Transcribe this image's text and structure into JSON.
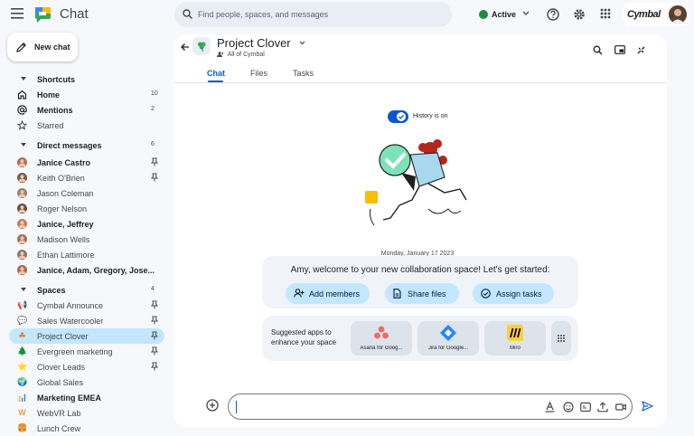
{
  "app": {
    "title": "Chat",
    "search_placeholder": "Find people, spaces, and messages"
  },
  "status": {
    "label": "Active",
    "color": "#1e8e3e"
  },
  "brand": {
    "name": "Cymbal"
  },
  "sidebar": {
    "new_chat_label": "New chat",
    "shortcuts": {
      "label": "Shortcuts",
      "items": [
        {
          "label": "Home",
          "count": "10",
          "icon": "home-icon",
          "bold": true
        },
        {
          "label": "Mentions",
          "count": "2",
          "icon": "at-icon",
          "bold": true
        },
        {
          "label": "Starred",
          "count": "",
          "icon": "star-icon",
          "bold": false
        }
      ]
    },
    "direct_messages": {
      "label": "Direct messages",
      "count": "6",
      "items": [
        {
          "label": "Janice Castro",
          "bold": true,
          "pin": true,
          "color": "#b0705a"
        },
        {
          "label": "Keith O'Brien",
          "bold": false,
          "pin": true,
          "color": "#7a5a4a"
        },
        {
          "label": "Jason Coleman",
          "bold": false,
          "pin": false,
          "color": "#9a8070"
        },
        {
          "label": "Roger Nelson",
          "bold": false,
          "pin": false,
          "color": "#6a5040"
        },
        {
          "label": "Janice, Jeffrey",
          "bold": true,
          "pin": false,
          "color": "#c08060"
        },
        {
          "label": "Madison Wells",
          "bold": false,
          "pin": false,
          "color": "#a07060"
        },
        {
          "label": "Ethan Lattimore",
          "bold": false,
          "pin": false,
          "color": "#8a7a70"
        },
        {
          "label": "Janice, Adam, Gregory, Jose...",
          "bold": true,
          "pin": false,
          "color": "#b06850"
        }
      ]
    },
    "spaces": {
      "label": "Spaces",
      "count": "4",
      "items": [
        {
          "label": "Cymbal Announce",
          "bold": false,
          "pin": true,
          "emoji": "📢"
        },
        {
          "label": "Sales Watercooler",
          "bold": false,
          "pin": true,
          "emoji": "💬"
        },
        {
          "label": "Project Clover",
          "bold": false,
          "pin": true,
          "emoji": "☘",
          "selected": true
        },
        {
          "label": "Evergreen marketing",
          "bold": false,
          "pin": true,
          "emoji": "🌲"
        },
        {
          "label": "Clover Leads",
          "bold": false,
          "pin": true,
          "emoji": "⭐"
        },
        {
          "label": "Global Sales",
          "bold": false,
          "pin": false,
          "emoji": "🌍"
        },
        {
          "label": "Marketing EMEA",
          "bold": true,
          "pin": false,
          "emoji": "📊"
        },
        {
          "label": "WebVR Lab",
          "bold": false,
          "pin": false,
          "emoji": "W"
        },
        {
          "label": "Lunch Crew",
          "bold": false,
          "pin": false,
          "emoji": "🍔"
        }
      ]
    }
  },
  "space": {
    "name": "Project Clover",
    "subtitle": "All of Cymbal",
    "tabs": [
      {
        "label": "Chat",
        "active": true
      },
      {
        "label": "Files"
      },
      {
        "label": "Tasks"
      }
    ],
    "history_label": "History is on",
    "date_label": "Monday, January 17 2023",
    "welcome_text": "Amy, welcome to your new collaboration space! Let's get started:",
    "actions": [
      {
        "label": "Add members",
        "icon": "add-person-icon"
      },
      {
        "label": "Share files",
        "icon": "file-icon"
      },
      {
        "label": "Assign tasks",
        "icon": "task-icon"
      }
    ],
    "suggested_text": "Suggested apps to enhance your space",
    "apps": [
      {
        "label": "Asana for Goog...",
        "color": "#f06a6a"
      },
      {
        "label": "Jira for Google...",
        "color": "#2684ff"
      },
      {
        "label": "Miro",
        "color": "#ffd02f"
      }
    ]
  }
}
